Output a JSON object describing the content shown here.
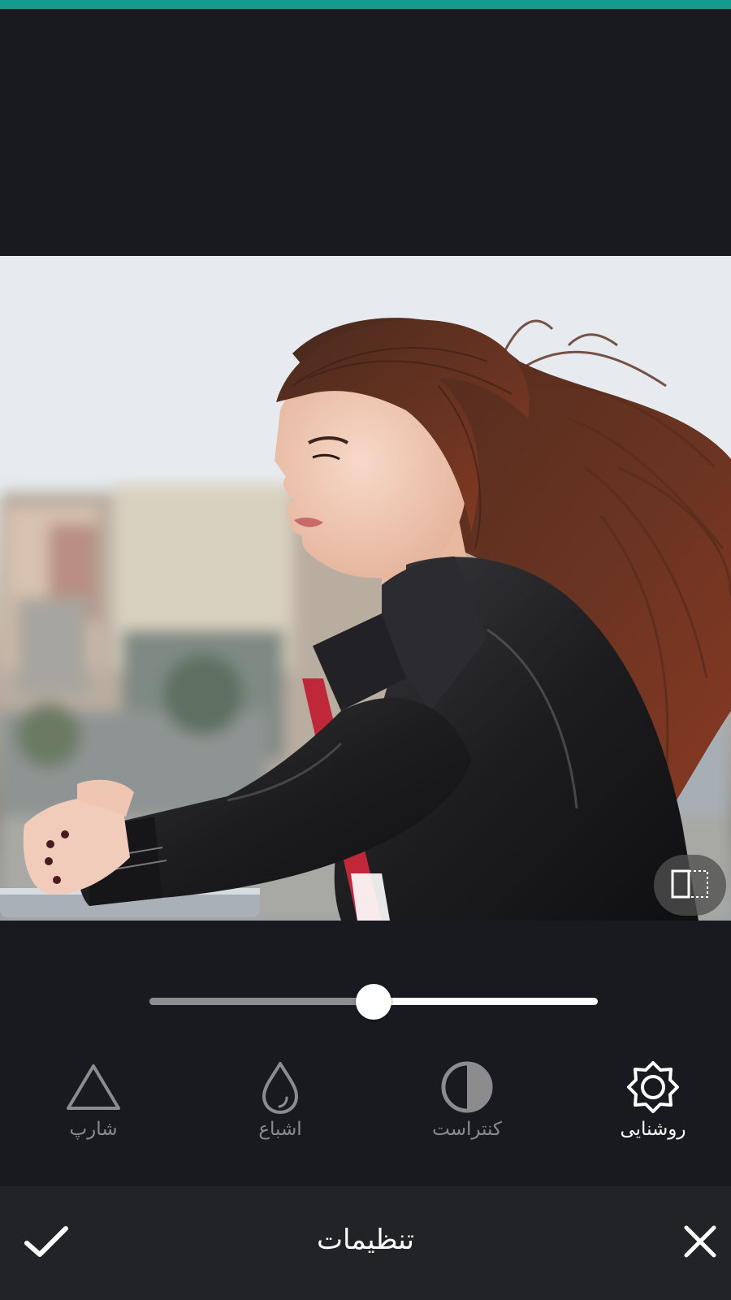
{
  "colors": {
    "accent": "#159a8c",
    "background": "#181a20",
    "bottom_bar": "#222326",
    "inactive": "#8c8c8e",
    "active": "#ffffff"
  },
  "slider": {
    "value_fraction": 0.5
  },
  "tools": [
    {
      "label": "روشنایی",
      "icon": "brightness-icon",
      "active": true
    },
    {
      "label": "کنتراست",
      "icon": "contrast-icon",
      "active": false
    },
    {
      "label": "اشباع",
      "icon": "saturation-drop-icon",
      "active": false
    },
    {
      "label": "شارپ",
      "icon": "sharpen-triangle-icon",
      "active": false
    }
  ],
  "bottom_bar": {
    "title": "تنظیمات",
    "confirm_icon": "check-icon",
    "cancel_icon": "close-icon"
  },
  "compare_button": {
    "icon": "compare-split-icon"
  }
}
